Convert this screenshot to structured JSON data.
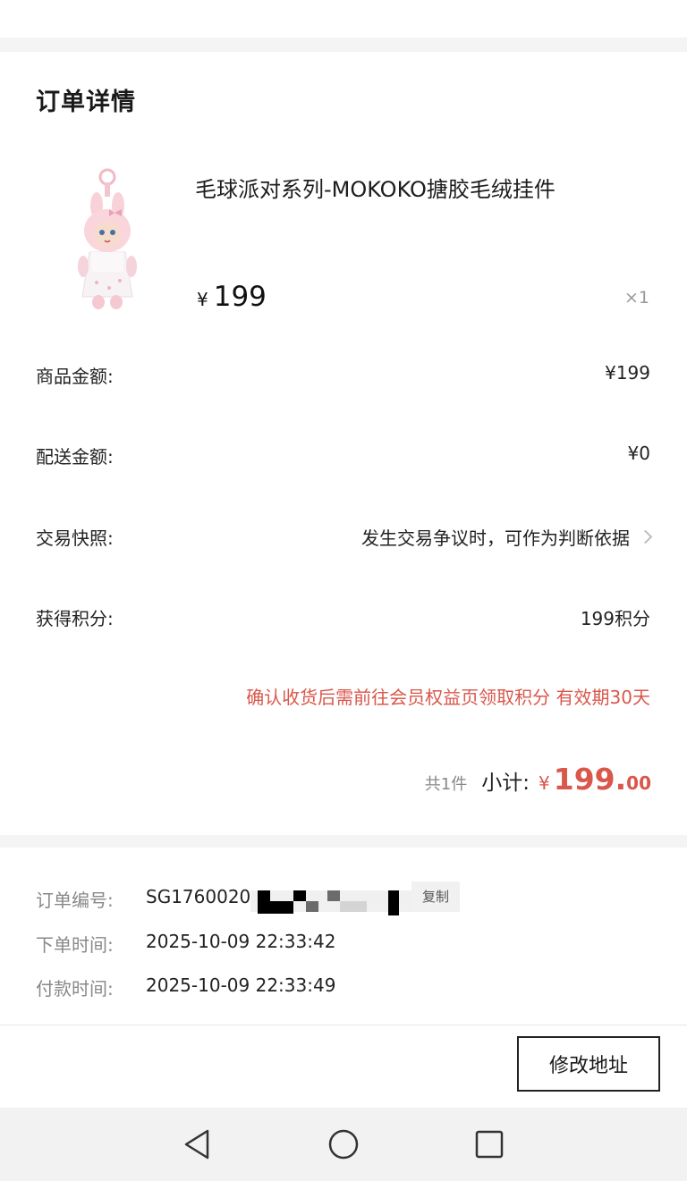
{
  "page": {
    "title": "订单详情"
  },
  "product": {
    "name": "毛球派对系列-MOKOKO搪胶毛绒挂件",
    "currency": "¥",
    "price": "199",
    "quantity": "×1"
  },
  "summary": {
    "rows": [
      {
        "label": "商品金额:",
        "value": "¥199"
      },
      {
        "label": "配送金额:",
        "value": "¥0"
      },
      {
        "label": "交易快照:",
        "value": "发生交易争议时，可作为判断依据"
      },
      {
        "label": "获得积分:",
        "value": "199积分"
      }
    ],
    "note": "确认收货后需前往会员权益页领取积分 有效期30天",
    "count": "共1件",
    "subtotal_label": "小计:",
    "subtotal_currency": "¥",
    "subtotal_int": "199.",
    "subtotal_dec": "00"
  },
  "order_info": {
    "order_no_label": "订单编号:",
    "order_no_value": "SG1760020",
    "copy_label": "复制",
    "order_time_label": "下单时间:",
    "order_time_value": "2025-10-09 22:33:42",
    "pay_time_label": "付款时间:",
    "pay_time_value": "2025-10-09 22:33:49"
  },
  "footer": {
    "modify_address": "修改地址"
  },
  "nav": {
    "icons": [
      "back-triangle-icon",
      "home-circle-icon",
      "recents-square-icon"
    ]
  }
}
